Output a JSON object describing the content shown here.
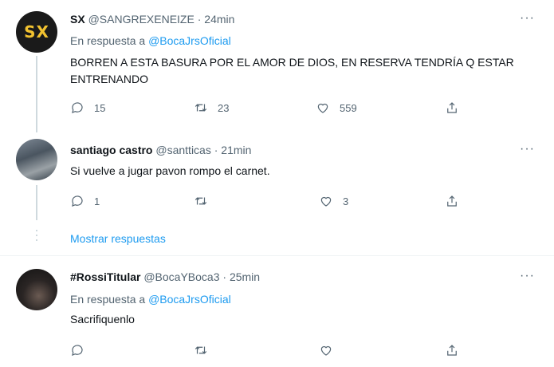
{
  "tweets": [
    {
      "name": "SX",
      "handle": "@SANGREXENEIZE",
      "sep": "·",
      "time": "24min",
      "avatar_text": "SX",
      "reply_prefix": "En respuesta a",
      "reply_mention": "@BocaJrsOficial",
      "text": "BORREN A ESTA BASURA POR EL AMOR DE DIOS, EN RESERVA TENDRÍA Q ESTAR ENTRENANDO",
      "replies": "15",
      "retweets": "23",
      "likes": "559"
    },
    {
      "name": "santiago castro",
      "handle": "@santticas",
      "sep": "·",
      "time": "21min",
      "text": "Si vuelve a jugar pavon rompo el carnet.",
      "replies": "1",
      "retweets": "",
      "likes": "3"
    },
    {
      "name": "#RossiTitular",
      "handle": "@BocaYBoca3",
      "sep": "·",
      "time": "25min",
      "reply_prefix": "En respuesta a",
      "reply_mention": "@BocaJrsOficial",
      "text": "Sacrifiquenlo",
      "replies": "",
      "retweets": "",
      "likes": ""
    }
  ],
  "thread": {
    "show_replies": "Mostrar respuestas"
  },
  "more_glyph": "···",
  "colors": {
    "accent": "#1d9bf0",
    "muted": "#536471",
    "thread_line": "#cfd9de"
  }
}
